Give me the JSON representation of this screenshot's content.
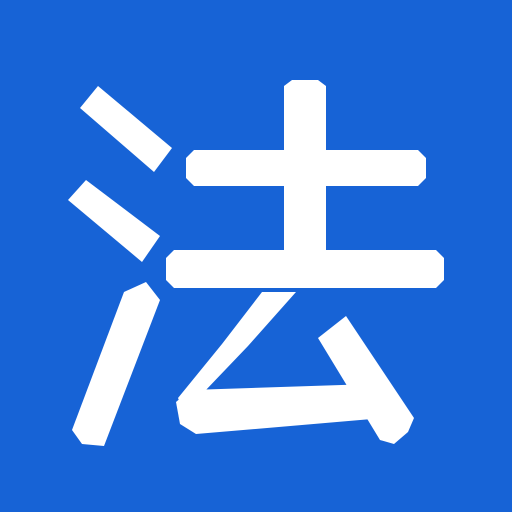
{
  "icon": {
    "glyph": "法",
    "background_color": "#1763D6",
    "glyph_color": "#FFFFFF"
  }
}
